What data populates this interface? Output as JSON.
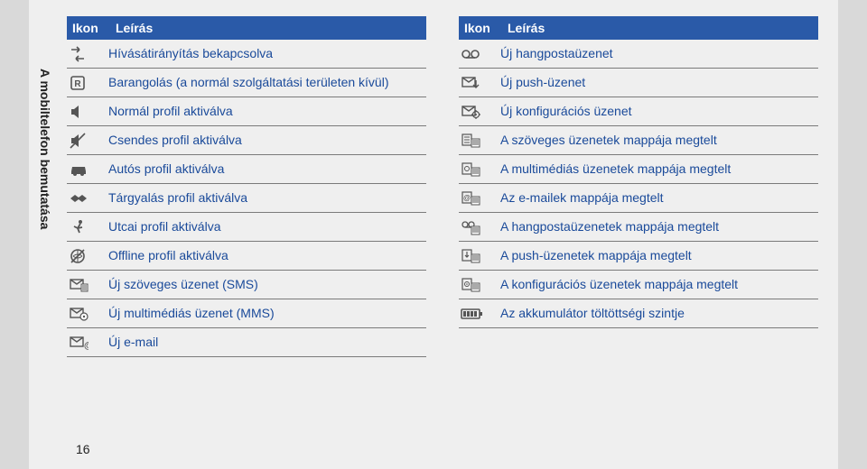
{
  "sidelabel": "A mobiltelefon bemutatása",
  "page_number": "16",
  "header": {
    "ikon": "Ikon",
    "leiras": "Leírás"
  },
  "left": [
    {
      "icon": "call-forward-icon",
      "text": "Hívásátirányítás bekapcsolva"
    },
    {
      "icon": "roaming-icon",
      "text": "Barangolás (a normál szolgáltatási területen kívül)"
    },
    {
      "icon": "speaker-icon",
      "text": "Normál profil aktiválva"
    },
    {
      "icon": "speaker-mute-icon",
      "text": "Csendes profil aktiválva"
    },
    {
      "icon": "car-icon",
      "text": "Autós profil aktiválva"
    },
    {
      "icon": "handshake-icon",
      "text": "Tárgyalás profil aktiválva"
    },
    {
      "icon": "runner-icon",
      "text": "Utcai profil aktiválva"
    },
    {
      "icon": "offline-icon",
      "text": "Offline profil aktiválva"
    },
    {
      "icon": "sms-icon",
      "text": "Új szöveges üzenet (SMS)"
    },
    {
      "icon": "mms-icon",
      "text": "Új multimédiás üzenet (MMS)"
    },
    {
      "icon": "email-new-icon",
      "text": "Új e-mail"
    }
  ],
  "right": [
    {
      "icon": "voicemail-icon",
      "text": "Új hangpostaüzenet"
    },
    {
      "icon": "push-msg-icon",
      "text": "Új push-üzenet"
    },
    {
      "icon": "config-msg-icon",
      "text": "Új konfigurációs üzenet"
    },
    {
      "icon": "sms-full-icon",
      "text": "A szöveges üzenetek mappája megtelt"
    },
    {
      "icon": "mms-full-icon",
      "text": "A multimédiás üzenetek mappája megtelt"
    },
    {
      "icon": "email-full-icon",
      "text": "Az e-mailek mappája megtelt"
    },
    {
      "icon": "voicemail-full-icon",
      "text": "A hangpostaüzenetek mappája megtelt"
    },
    {
      "icon": "push-full-icon",
      "text": "A push-üzenetek mappája megtelt"
    },
    {
      "icon": "config-full-icon",
      "text": "A konfigurációs üzenetek mappája megtelt"
    },
    {
      "icon": "battery-icon",
      "text": "Az akkumulátor töltöttségi szintje"
    }
  ]
}
